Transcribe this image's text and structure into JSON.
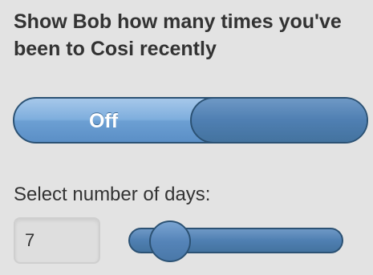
{
  "heading": "Show Bob how many times you've been to Cosi recently",
  "toggle": {
    "label": "Off",
    "state": "off"
  },
  "days": {
    "label": "Select number of days:",
    "value": "7",
    "slider_fraction": 0.18
  },
  "colors": {
    "background": "#e3e3e3",
    "toggle_blue": "#7eaedd",
    "control_dark_blue": "#4f7fb2",
    "border_blue": "#2c5274"
  }
}
